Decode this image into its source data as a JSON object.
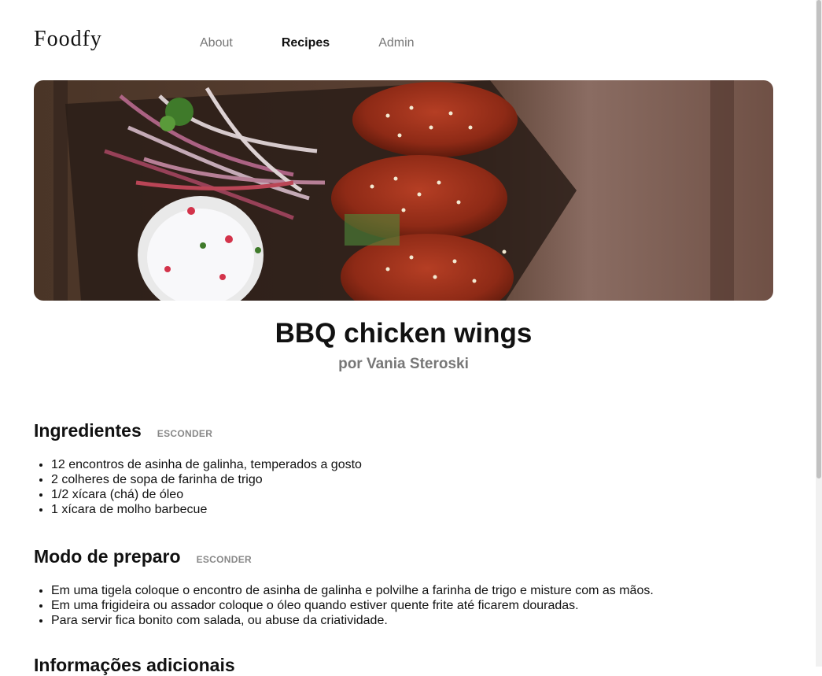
{
  "header": {
    "logo": "Foodfy",
    "nav": [
      {
        "label": "About"
      },
      {
        "label": "Recipes",
        "active": true
      },
      {
        "label": "Admin"
      }
    ]
  },
  "recipe": {
    "image_alt": "BBQ chicken wings photo",
    "title": "BBQ chicken wings",
    "author": "por Vania Steroski"
  },
  "ingredients": {
    "title": "Ingredientes",
    "toggle": "ESCONDER",
    "items": [
      "12 encontros de asinha de galinha, temperados a gosto",
      "2 colheres de sopa de farinha de trigo",
      "1/2 xícara (chá) de óleo",
      "1 xícara de molho barbecue"
    ]
  },
  "preparation": {
    "title": "Modo de preparo",
    "toggle": "ESCONDER",
    "items": [
      "Em uma tigela coloque o encontro de asinha de galinha e polvilhe a farinha de trigo e misture com as mãos.",
      "Em uma frigideira ou assador coloque o óleo quando estiver quente frite até ficarem douradas.",
      "Para servir fica bonito com salada, ou abuse da criatividade."
    ]
  },
  "additional": {
    "title": "Informações adicionais"
  },
  "colors": {
    "muted": "#777777",
    "text": "#111111"
  }
}
